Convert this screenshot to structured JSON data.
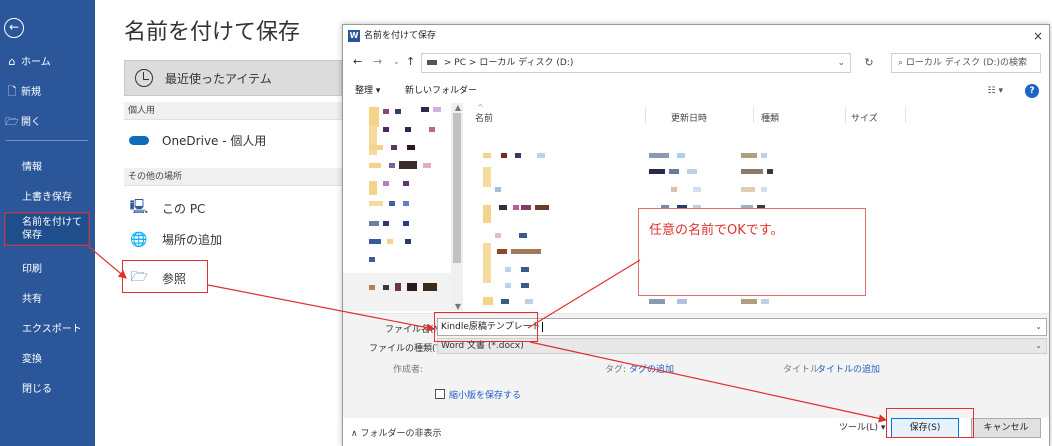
{
  "sidebar": {
    "back_icon": "back-arrow-icon",
    "top_items": [
      {
        "icon": "⌂",
        "label": "ホーム"
      },
      {
        "icon": "🗋",
        "label": "新規"
      },
      {
        "icon": "🗁",
        "label": "開く"
      }
    ],
    "sub_items": [
      "情報",
      "上書き保存",
      "名前を付けて保存",
      "印刷",
      "共有",
      "エクスポート",
      "変換",
      "閉じる"
    ],
    "active_index": 2
  },
  "backstage": {
    "title": "名前を付けて保存",
    "recent_label": "最近使ったアイテム",
    "section_personal": "個人用",
    "onedrive_label": "OneDrive - 個人用",
    "section_other": "その他の場所",
    "this_pc_label": "この PC",
    "add_place_label": "場所の追加",
    "browse_label": "参照"
  },
  "dialog": {
    "title": "名前を付けて保存",
    "close": "×",
    "address": {
      "pc": "PC",
      "sep": ">",
      "drive": "ローカル ディスク (D:)"
    },
    "search_placeholder": "ローカル ディスク (D:)の検索",
    "organize": "整理 ▾",
    "new_folder": "新しいフォルダー",
    "view_icon": "☷ ▾",
    "help": "?",
    "columns": [
      "名前",
      "更新日時",
      "種類",
      "サイズ"
    ],
    "filename_label": "ファイル名(N):",
    "filename_value": "Kindle原稿テンプレート",
    "filetype_label": "ファイルの種類(T):",
    "filetype_value": "Word 文書 (*.docx)",
    "author_label": "作成者:",
    "tags_label": "タグ:",
    "tags_link": "タグの追加",
    "title_label": "タイトル:",
    "title_link": "タイトルの追加",
    "thumbnail_label": "縮小版を保存する",
    "hide_folders": "∧ フォルダーの非表示",
    "tools": "ツール(L) ▾",
    "save_btn": "保存(S)",
    "cancel_btn": "キャンセル"
  },
  "callout": "任意の名前でOKです。",
  "colors": {
    "brand": "#2b579a",
    "annotation": "#e03030"
  }
}
